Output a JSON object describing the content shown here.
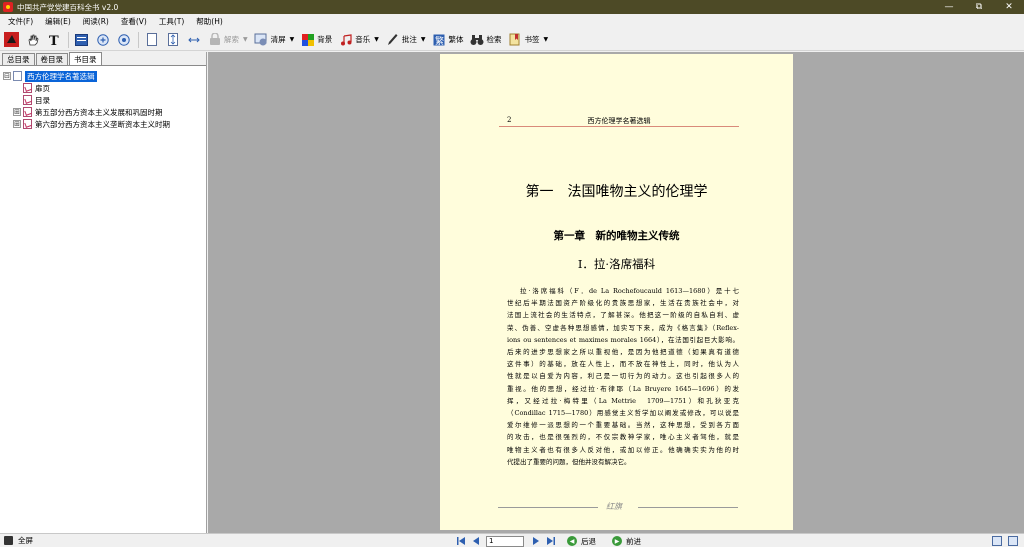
{
  "window": {
    "title": "中国共产党党建百科全书 v2.0",
    "controls": [
      "—",
      "⧉",
      "✕"
    ]
  },
  "menu": [
    "文件(F)",
    "编辑(E)",
    "阅读(R)",
    "查看(V)",
    "工具(T)",
    "帮助(H)"
  ],
  "toolbar": {
    "unlock_label": "解索",
    "clear_label": "清屏",
    "background_label": "背景",
    "music_label": "音乐",
    "annotate_label": "批注",
    "traditional_label": "繁体",
    "search_label": "检索",
    "bookmark_label": "书签"
  },
  "left_panel": {
    "tabs": [
      "总目录",
      "卷目录",
      "书目录"
    ],
    "active_tab": 2,
    "tree": [
      {
        "label": "西方伦理学名著选辑",
        "expander": "⊟",
        "selected": true,
        "level": 0
      },
      {
        "label": "扉页",
        "level": 1
      },
      {
        "label": "目录",
        "level": 1
      },
      {
        "label": "第五部分西方资本主义发展和巩固时期",
        "expander": "⊞",
        "level": 1
      },
      {
        "label": "第六部分西方资本主义垄断资本主义时期",
        "expander": "⊞",
        "level": 1
      }
    ]
  },
  "page": {
    "page_number": "2",
    "running_head": "西方伦理学名著选辑",
    "part_title": "第一　法国唯物主义的伦理学",
    "chapter_title": "第一章　新的唯物主义传统",
    "section_title": "Ⅰ．拉·洛席福科",
    "body_lines": [
      "拉·洛席福科（F．de La Rochefoucauld 1613—1680）是十七",
      "世纪后半期法国资产阶级化的贵族思想家，生活在贵族社会中，对",
      "法国上流社会的生活特点，了解甚深。他把这一阶级的自私自利、虚",
      "荣、伪善、空虚各种思想感情，加实写下来，成为《格言集》（Reflex-",
      "ions ou sentences et maximes morales 1664），在法国引起巨大影响。",
      "后来的进步思想家之所以重视他，是因为他把道德（如果真有道德",
      "这件事）的基础，放在人性上，而不放在神性上，同时，他认为人",
      "性就是以自爱为内容，利己是一切行为的动力。这也引起很多人的",
      "重视。他的思想，经过拉·布律耶（La Bruyere 1645—1696）的发",
      "挥，又经过拉·梅特里（La Mettrie　1709—1751）和孔狄亚克",
      "（Condillac 1715—1780）用感觉主义哲学加以阐发或修改，可以说是",
      "爱尔维修一派思想的一个重要基础。当然，这种思想，受到各方面",
      "的攻击，也是很强烈的，不仅宗教神学家，唯心主义者驾他，就是",
      "唯物主义者也有很多人反对他，或加以修正。他确确实实为他的时",
      "代提出了重要的问题，但他并没有解决它。"
    ],
    "footer_mark": "红旗"
  },
  "status": {
    "fullscreen_label": "全屏",
    "current_page": "1",
    "back_label": "后退",
    "forward_label": "前进"
  },
  "colors": {
    "titlebar": "#4d4a26",
    "page_background": "#fffddc",
    "viewer_background": "#a9a9a9",
    "selection": "#0a64d8",
    "rule": "#d98a7a"
  }
}
